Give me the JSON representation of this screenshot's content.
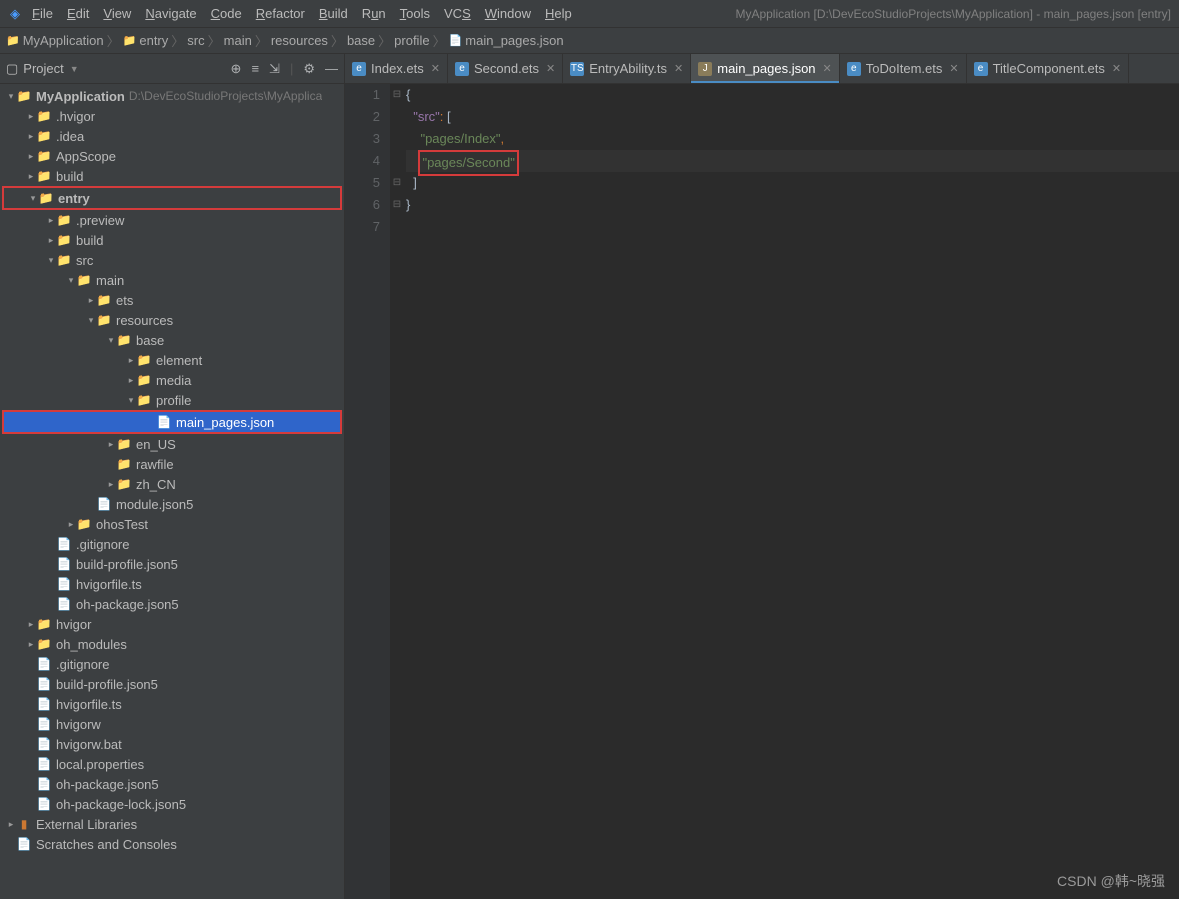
{
  "window": {
    "title": "MyApplication [D:\\DevEcoStudioProjects\\MyApplication] - main_pages.json [entry]"
  },
  "menubar": {
    "items": [
      "File",
      "Edit",
      "View",
      "Navigate",
      "Code",
      "Refactor",
      "Build",
      "Run",
      "Tools",
      "VCS",
      "Window",
      "Help"
    ]
  },
  "breadcrumb": {
    "items": [
      "MyApplication",
      "entry",
      "src",
      "main",
      "resources",
      "base",
      "profile",
      "main_pages.json"
    ]
  },
  "project_panel": {
    "title": "Project"
  },
  "tree": {
    "root_name": "MyApplication",
    "root_path": "D:\\DevEcoStudioProjects\\MyApplica",
    "items": {
      "hvigor": ".hvigor",
      "idea": ".idea",
      "appscope": "AppScope",
      "build": "build",
      "entry": "entry",
      "preview": ".preview",
      "build2": "build",
      "src": "src",
      "main": "main",
      "ets": "ets",
      "resources": "resources",
      "base": "base",
      "element": "element",
      "media": "media",
      "profile": "profile",
      "main_pages": "main_pages.json",
      "en_us": "en_US",
      "rawfile": "rawfile",
      "zh_cn": "zh_CN",
      "module_json5": "module.json5",
      "ohostest": "ohosTest",
      "gitignore1": ".gitignore",
      "buildprofile1": "build-profile.json5",
      "hvigorfile1": "hvigorfile.ts",
      "ohpackage1": "oh-package.json5",
      "hvigor2": "hvigor",
      "oh_modules": "oh_modules",
      "gitignore2": ".gitignore",
      "buildprofile2": "build-profile.json5",
      "hvigorfile2": "hvigorfile.ts",
      "hvigorw": "hvigorw",
      "hvigorw_bat": "hvigorw.bat",
      "local_props": "local.properties",
      "ohpackage2": "oh-package.json5",
      "ohpackagelock": "oh-package-lock.json5",
      "ext_libs": "External Libraries",
      "scratches": "Scratches and Consoles"
    }
  },
  "tabs": [
    {
      "label": "Index.ets",
      "icon": "ets"
    },
    {
      "label": "Second.ets",
      "icon": "ets"
    },
    {
      "label": "EntryAbility.ts",
      "icon": "ts"
    },
    {
      "label": "main_pages.json",
      "icon": "json",
      "active": true
    },
    {
      "label": "ToDoItem.ets",
      "icon": "ets"
    },
    {
      "label": "TitleComponent.ets",
      "icon": "ets"
    }
  ],
  "code": {
    "line_numbers": [
      "1",
      "2",
      "3",
      "4",
      "5",
      "6",
      "7"
    ],
    "l1": "{",
    "l2_key": "\"src\"",
    "l2_colon": ":",
    "l2_bracket": " [",
    "l3": "\"pages/Index\"",
    "l3_comma": ",",
    "l4": "\"pages/Second\"",
    "l5": "]",
    "l6": "}"
  },
  "watermark": "CSDN @韩~晓强"
}
